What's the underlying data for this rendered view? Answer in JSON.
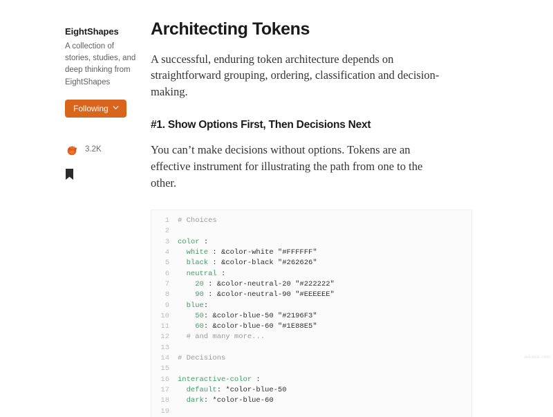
{
  "sidebar": {
    "publication_name": "EightShapes",
    "publication_description": "A collection of stories, studies, and deep thinking from EightShapes",
    "follow_button": {
      "label": "Following",
      "icon": "chevron-down-icon",
      "background_color": "#d9651c",
      "text_color": "#ffffff"
    },
    "clap": {
      "icon": "clapping-hands-icon",
      "count": "3.2K"
    },
    "bookmark": {
      "icon": "bookmark-icon"
    }
  },
  "article": {
    "title": "Architecting Tokens",
    "lede": "A successful, enduring token architecture depends on straightforward grouping, ordering, classification and decision-making.",
    "section_heading": "#1. Show Options First, Then Decisions Next",
    "body_paragraph": "You can’t make decisions without options. Tokens are an effective instrument for illustrating the path from one to the other."
  },
  "code_block": {
    "language": "yaml",
    "colors": {
      "comment": "#9a9a9a",
      "key": "#3f9e62",
      "plain": "#2e2e2e",
      "line_number": "#bdbdbd",
      "background": "#fbfbfb"
    },
    "lines": [
      {
        "number": "1",
        "segments": [
          {
            "text": "# Choices",
            "type": "comment"
          }
        ]
      },
      {
        "number": "2",
        "segments": []
      },
      {
        "number": "3",
        "segments": [
          {
            "text": "color",
            "type": "key"
          },
          {
            "text": " :",
            "type": "plain"
          }
        ]
      },
      {
        "number": "4",
        "segments": [
          {
            "text": "  white",
            "type": "key"
          },
          {
            "text": " : &color-white \"#FFFFFF\"",
            "type": "plain"
          }
        ]
      },
      {
        "number": "5",
        "segments": [
          {
            "text": "  black",
            "type": "key"
          },
          {
            "text": " : &color-black \"#262626\"",
            "type": "plain"
          }
        ]
      },
      {
        "number": "6",
        "segments": [
          {
            "text": "  neutral",
            "type": "key"
          },
          {
            "text": " :",
            "type": "plain"
          }
        ]
      },
      {
        "number": "7",
        "segments": [
          {
            "text": "    20",
            "type": "key"
          },
          {
            "text": " : &color-neutral-20 \"#222222\"",
            "type": "plain"
          }
        ]
      },
      {
        "number": "8",
        "segments": [
          {
            "text": "    90",
            "type": "key"
          },
          {
            "text": " : &color-neutral-90 \"#EEEEEE\"",
            "type": "plain"
          }
        ]
      },
      {
        "number": "9",
        "segments": [
          {
            "text": "  blue",
            "type": "key"
          },
          {
            "text": ":",
            "type": "plain"
          }
        ]
      },
      {
        "number": "10",
        "segments": [
          {
            "text": "    50",
            "type": "key"
          },
          {
            "text": ": &color-blue-50 \"#2196F3\"",
            "type": "plain"
          }
        ]
      },
      {
        "number": "11",
        "segments": [
          {
            "text": "    60",
            "type": "key"
          },
          {
            "text": ": &color-blue-60 \"#1E88E5\"",
            "type": "plain"
          }
        ]
      },
      {
        "number": "12",
        "segments": [
          {
            "text": "  # and many more...",
            "type": "comment"
          }
        ]
      },
      {
        "number": "13",
        "segments": []
      },
      {
        "number": "14",
        "segments": [
          {
            "text": "# Decisions",
            "type": "comment"
          }
        ]
      },
      {
        "number": "15",
        "segments": []
      },
      {
        "number": "16",
        "segments": [
          {
            "text": "interactive-color",
            "type": "key"
          },
          {
            "text": " :",
            "type": "plain"
          }
        ]
      },
      {
        "number": "17",
        "segments": [
          {
            "text": "  default",
            "type": "key"
          },
          {
            "text": ": *color-blue-50",
            "type": "plain"
          }
        ]
      },
      {
        "number": "18",
        "segments": [
          {
            "text": "  dark",
            "type": "key"
          },
          {
            "text": ": *color-blue-60",
            "type": "plain"
          }
        ]
      },
      {
        "number": "19",
        "segments": []
      }
    ]
  },
  "watermark": {
    "text": "wikidok.com"
  }
}
